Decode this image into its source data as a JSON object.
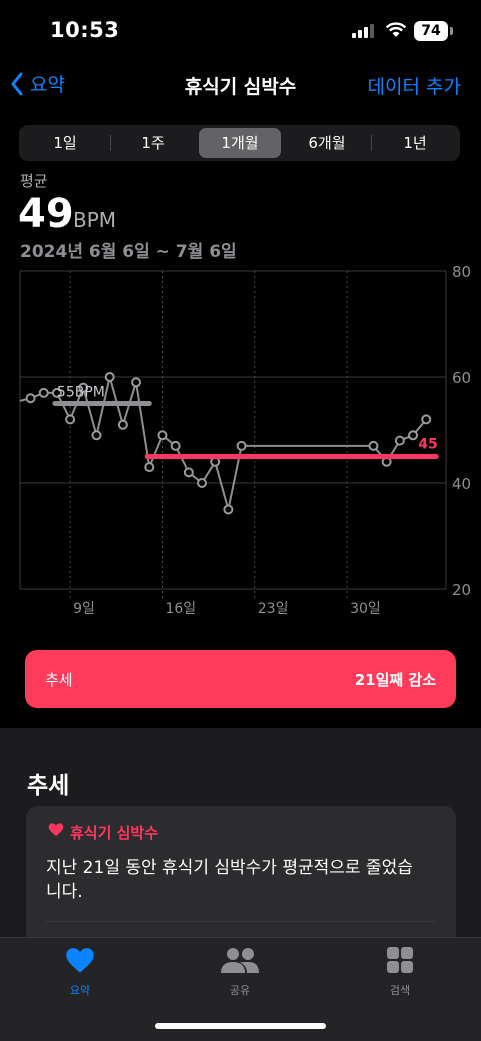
{
  "status_bar": {
    "time": "10:53",
    "battery": "74"
  },
  "nav": {
    "back_label": "요약",
    "title": "휴식기 심박수",
    "action_label": "데이터 추가"
  },
  "segments": [
    "1일",
    "1주",
    "1개월",
    "6개월",
    "1년"
  ],
  "selected_segment": "1개월",
  "summary": {
    "label": "평균",
    "value": "49",
    "unit": "BPM",
    "date_range": "2024년 6월 6일 ~ 7월 6일"
  },
  "chart_data": {
    "type": "line",
    "y_ticks": [
      "80",
      "60",
      "40",
      "20"
    ],
    "ylim": [
      20,
      80
    ],
    "x_tick_labels": [
      "9일",
      "16일",
      "23일",
      "30일"
    ],
    "x_ticks_day_index": [
      3,
      10,
      17,
      24
    ],
    "series": [
      {
        "values": [
          {
            "day": 0,
            "bpm": 56
          },
          {
            "day": 1,
            "bpm": 57
          },
          {
            "day": 2,
            "bpm": 57
          },
          {
            "day": 3,
            "bpm": 52
          },
          {
            "day": 4,
            "bpm": 58
          },
          {
            "day": 5,
            "bpm": 49
          },
          {
            "day": 6,
            "bpm": 60
          },
          {
            "day": 7,
            "bpm": 51
          },
          {
            "day": 8,
            "bpm": 59
          },
          {
            "day": 9,
            "bpm": 43
          },
          {
            "day": 10,
            "bpm": 49
          },
          {
            "day": 11,
            "bpm": 47
          },
          {
            "day": 12,
            "bpm": 42
          },
          {
            "day": 13,
            "bpm": 40
          },
          {
            "day": 14,
            "bpm": 44
          },
          {
            "day": 15,
            "bpm": 35
          },
          {
            "day": 16,
            "bpm": 47
          },
          {
            "day": 26,
            "bpm": 47
          },
          {
            "day": 27,
            "bpm": 44
          },
          {
            "day": 28,
            "bpm": 48
          },
          {
            "day": 29,
            "bpm": 49
          },
          {
            "day": 30,
            "bpm": 52
          }
        ]
      }
    ],
    "averages": [
      {
        "label": "55BPM",
        "value": 55,
        "from_day": 2,
        "to_day": 9,
        "color": "#8e8e93"
      },
      {
        "label": "45",
        "value": 45,
        "from_day": 9,
        "to_day": 30,
        "color": "#ff375f"
      }
    ],
    "grid": true
  },
  "trend_banner": {
    "label": "추세",
    "value": "21일째 감소"
  },
  "trends_section": {
    "title": "추세",
    "card_title": "휴식기 심박수",
    "card_body": "지난 21일 동안 휴식기 심박수가 평균적으로 줄었습니다."
  },
  "tabbar": {
    "items": [
      {
        "label": "요약"
      },
      {
        "label": "공유"
      },
      {
        "label": "검색"
      }
    ]
  },
  "colors": {
    "accent": "#0a84ff",
    "heart": "#ff375f",
    "banner": "#ff3b5c"
  }
}
